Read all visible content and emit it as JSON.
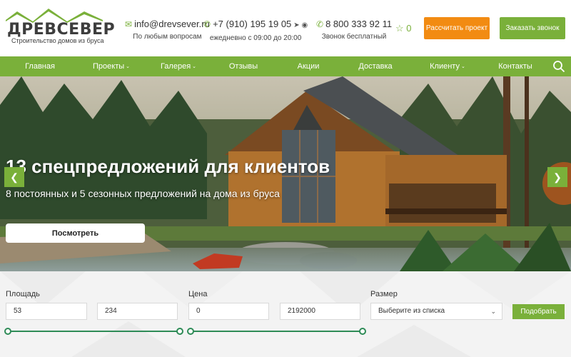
{
  "brand": {
    "name": "ДРЕВСЕВЕР",
    "tagline": "Строительство домов из бруса",
    "colors": {
      "accent": "#7ab03a",
      "orange": "#f28b12"
    }
  },
  "contacts": {
    "email": {
      "icon": "mail-icon",
      "value": "info@drevsever.ru",
      "note": "По любым вопросам"
    },
    "phone": {
      "icon": "phone-icon",
      "value": "+7 (910) 195 19 05",
      "note": "ежедневно с 09:00 до 20:00",
      "messengers": [
        "telegram-icon",
        "whatsapp-icon"
      ]
    },
    "tollfree": {
      "icon": "phone-icon",
      "value": "8 800 333 92 11",
      "note": "Звонок бесплатный"
    }
  },
  "favorites": {
    "icon": "star-icon",
    "count": "0"
  },
  "buttons": {
    "calculate": "Рассчитать проект",
    "callback": "Заказать звонок"
  },
  "nav": {
    "items": [
      {
        "label": "Главная",
        "dropdown": false
      },
      {
        "label": "Проекты",
        "dropdown": true
      },
      {
        "label": "Галерея",
        "dropdown": true
      },
      {
        "label": "Отзывы",
        "dropdown": false
      },
      {
        "label": "Акции",
        "dropdown": false
      },
      {
        "label": "Доставка",
        "dropdown": false
      },
      {
        "label": "Клиенту",
        "dropdown": true
      },
      {
        "label": "Контакты",
        "dropdown": false
      }
    ],
    "search_icon": "search-icon"
  },
  "hero": {
    "title": "13 спецпредложений для клиентов",
    "subtitle": "8 постоянных и 5 сезонных предложений на дома из бруса",
    "button": "Посмотреть"
  },
  "filter": {
    "area": {
      "label": "Площадь",
      "min": "53",
      "max": "234"
    },
    "price": {
      "label": "Цена",
      "min": "0",
      "max": "2192000"
    },
    "size": {
      "label": "Размер",
      "placeholder": "Выберите из списка"
    },
    "submit": "Подобрать"
  }
}
